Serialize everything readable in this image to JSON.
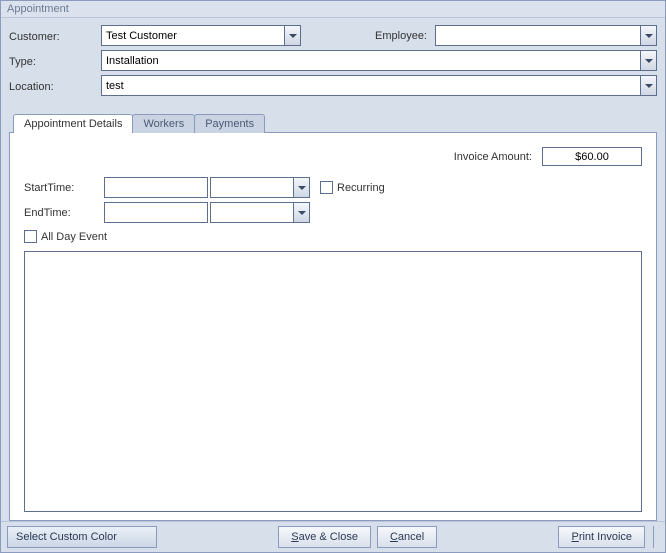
{
  "window": {
    "title": "Appointment"
  },
  "labels": {
    "customer": "Customer:",
    "employee": "Employee:",
    "type": "Type:",
    "location": "Location:",
    "invoice_amount": "Invoice Amount:",
    "start_time": "StartTime:",
    "end_time": "EndTime:",
    "recurring": "Recurring",
    "all_day": "All Day Event"
  },
  "fields": {
    "customer": "Test Customer",
    "employee": "",
    "type": "Installation",
    "location": "test",
    "invoice_amount": "$60.00",
    "start_date": "",
    "start_time": "",
    "end_date": "",
    "end_time": "",
    "recurring_checked": false,
    "all_day_checked": false,
    "notes": ""
  },
  "tabs": [
    {
      "label": "Appointment Details",
      "active": true
    },
    {
      "label": "Workers",
      "active": false
    },
    {
      "label": "Payments",
      "active": false
    }
  ],
  "buttons": {
    "select_color": "Select Custom Color",
    "save_close": {
      "hotkey": "S",
      "rest": "ave & Close"
    },
    "cancel": {
      "hotkey": "C",
      "rest": "ancel"
    },
    "print_invoice": {
      "hotkey": "P",
      "rest": "rint Invoice"
    }
  }
}
